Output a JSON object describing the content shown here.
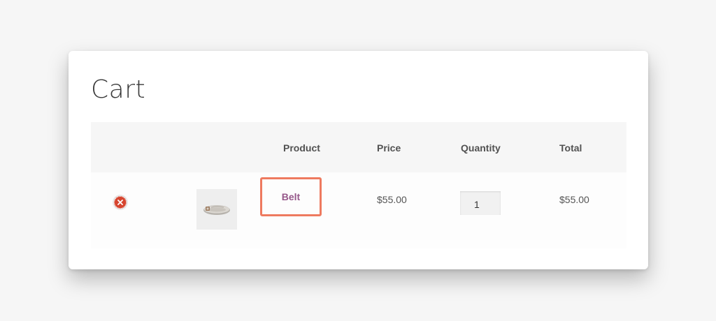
{
  "page": {
    "title": "Cart"
  },
  "table": {
    "headers": {
      "product": "Product",
      "price": "Price",
      "quantity": "Quantity",
      "total": "Total"
    },
    "rows": [
      {
        "product_name": "Belt",
        "price": "$55.00",
        "quantity": "1",
        "total": "$55.00",
        "remove_icon": "close-circle-icon",
        "thumbnail": "belt-product-image"
      }
    ]
  },
  "colors": {
    "product_link": "#96588a",
    "remove_icon": "#d6452f",
    "highlight_border": "#ee7a5f"
  }
}
